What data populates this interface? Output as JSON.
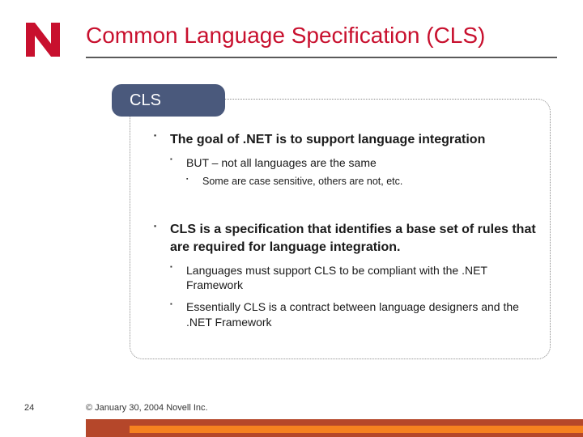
{
  "title": "Common Language Specification (CLS)",
  "section_label": "CLS",
  "b1": "The goal of .NET is to support language integration",
  "b1_1": "BUT – not all languages are the same",
  "b1_1_1": "Some are case sensitive, others are not, etc.",
  "b2": "CLS is a specification that identifies a base set of rules that are required for language integration.",
  "b2_1": "Languages must support CLS to be compliant with the .NET Framework",
  "b2_2": "Essentially CLS is a contract between language designers and the .NET Framework",
  "page_number": "24",
  "copyright": "© January 30, 2004 Novell Inc."
}
